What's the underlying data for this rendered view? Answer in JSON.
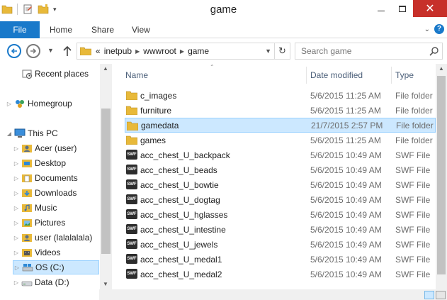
{
  "window": {
    "title": "game"
  },
  "ribbon": {
    "tabs": [
      "File",
      "Home",
      "Share",
      "View"
    ]
  },
  "address": {
    "prefix": "«",
    "crumbs": [
      "inetpub",
      "wwwroot",
      "game"
    ]
  },
  "search": {
    "placeholder": "Search game"
  },
  "nav": {
    "items": [
      {
        "label": "Recent places",
        "icon": "recent-places-icon"
      },
      {
        "label": "Homegroup",
        "icon": "homegroup-icon"
      },
      {
        "label": "This PC",
        "icon": "computer-icon"
      },
      {
        "label": "Acer (user)",
        "icon": "user-icon"
      },
      {
        "label": "Desktop",
        "icon": "desktop-icon"
      },
      {
        "label": "Documents",
        "icon": "documents-icon"
      },
      {
        "label": "Downloads",
        "icon": "downloads-icon"
      },
      {
        "label": "Music",
        "icon": "music-icon"
      },
      {
        "label": "Pictures",
        "icon": "pictures-icon"
      },
      {
        "label": "user (lalalalala)",
        "icon": "user-icon"
      },
      {
        "label": "Videos",
        "icon": "videos-icon"
      },
      {
        "label": "OS (C:)",
        "icon": "drive-c-icon"
      },
      {
        "label": "Data (D:)",
        "icon": "drive-d-icon"
      }
    ]
  },
  "columns": {
    "name": "Name",
    "date": "Date modified",
    "type": "Type"
  },
  "files": [
    {
      "name": "c_images",
      "date": "5/6/2015 11:25 AM",
      "type": "File folder",
      "kind": "folder"
    },
    {
      "name": "furniture",
      "date": "5/6/2015 11:25 AM",
      "type": "File folder",
      "kind": "folder"
    },
    {
      "name": "gamedata",
      "date": "21/7/2015 2:57 PM",
      "type": "File folder",
      "kind": "folder",
      "selected": true
    },
    {
      "name": "games",
      "date": "5/6/2015 11:25 AM",
      "type": "File folder",
      "kind": "folder"
    },
    {
      "name": "acc_chest_U_backpack",
      "date": "5/6/2015 10:49 AM",
      "type": "SWF File",
      "kind": "swf"
    },
    {
      "name": "acc_chest_U_beads",
      "date": "5/6/2015 10:49 AM",
      "type": "SWF File",
      "kind": "swf"
    },
    {
      "name": "acc_chest_U_bowtie",
      "date": "5/6/2015 10:49 AM",
      "type": "SWF File",
      "kind": "swf"
    },
    {
      "name": "acc_chest_U_dogtag",
      "date": "5/6/2015 10:49 AM",
      "type": "SWF File",
      "kind": "swf"
    },
    {
      "name": "acc_chest_U_hglasses",
      "date": "5/6/2015 10:49 AM",
      "type": "SWF File",
      "kind": "swf"
    },
    {
      "name": "acc_chest_U_intestine",
      "date": "5/6/2015 10:49 AM",
      "type": "SWF File",
      "kind": "swf"
    },
    {
      "name": "acc_chest_U_jewels",
      "date": "5/6/2015 10:49 AM",
      "type": "SWF File",
      "kind": "swf"
    },
    {
      "name": "acc_chest_U_medal1",
      "date": "5/6/2015 10:49 AM",
      "type": "SWF File",
      "kind": "swf"
    },
    {
      "name": "acc_chest_U_medal2",
      "date": "5/6/2015 10:49 AM",
      "type": "SWF File",
      "kind": "swf"
    }
  ],
  "colors": {
    "accent": "#1979ca",
    "selection": "#cce8ff",
    "selection_border": "#99d1ff",
    "folder": "#e8b93a",
    "close": "#c7302a"
  }
}
